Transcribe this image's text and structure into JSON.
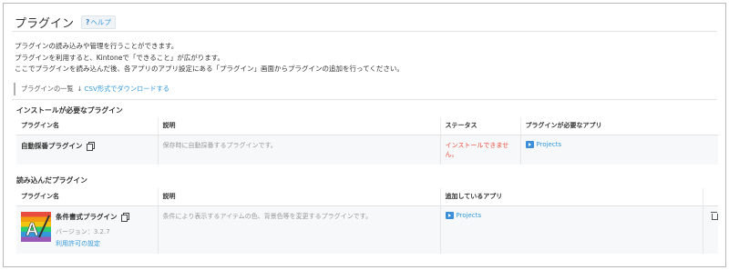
{
  "header": {
    "title": "プラグイン",
    "help_label": "ヘルプ",
    "help_icon": "question-icon"
  },
  "description": {
    "line1": "プラグインの読み込みや管理を行うことができます。",
    "line2": "プラグインを利用すると、Kintoneで「できること」が広がります。",
    "line3": "ここでプラグインを読み込んだ後、各アプリのアプリ設定にある「プラグイン」画面からプラグインの追加を行ってください。"
  },
  "toolbar": {
    "list_label": "プラグインの一覧",
    "download_icon": "download-icon",
    "download_label": "CSV形式でダウンロードする"
  },
  "install_section": {
    "title": "インストールが必要なプラグイン",
    "headers": [
      "プラグイン名",
      "説明",
      "ステータス",
      "プラグインが必要なアプリ"
    ],
    "row": {
      "name": "自動採番プラグイン",
      "description": "保存時に自動採番するプラグインです。",
      "status": "インストールできません。",
      "app": "Projects"
    }
  },
  "loaded_section": {
    "title": "読み込んだプラグイン",
    "headers": [
      "プラグイン名",
      "説明",
      "追加しているアプリ",
      ""
    ],
    "row": {
      "name": "条件書式プラグイン",
      "version": "バージョン：3.2.7",
      "license": "利用許可の設定",
      "description": "条件により表示するアイテムの色、背景色等を変更するプラグインです。",
      "app": "Projects"
    }
  },
  "colors": {
    "link": "#3498db",
    "error": "#e74c3c",
    "app_icon": "#3b8fd9"
  }
}
